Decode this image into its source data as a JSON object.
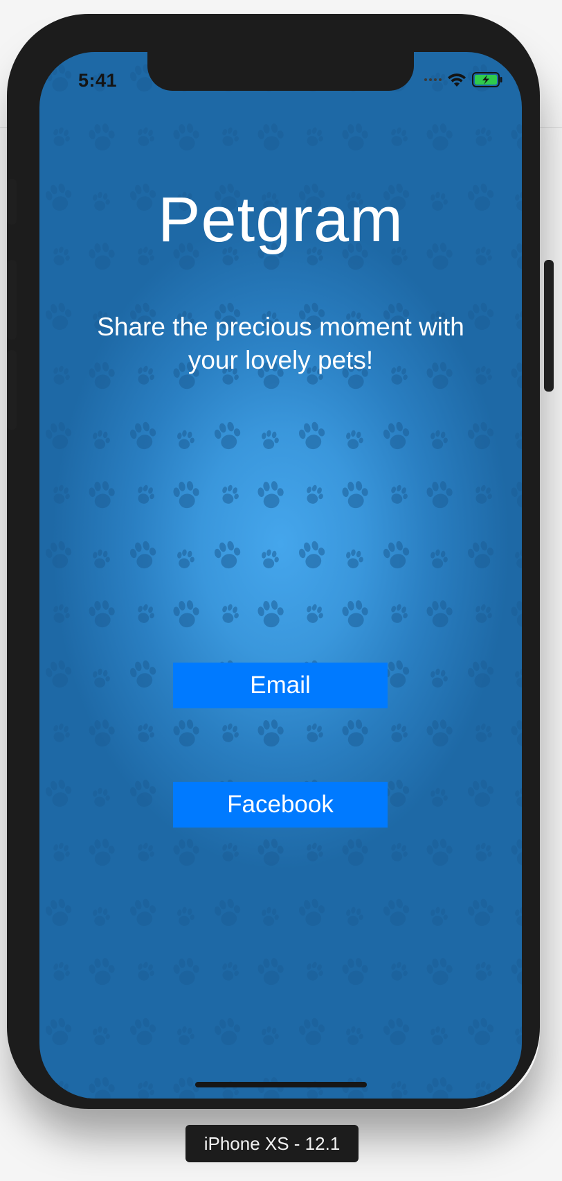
{
  "status_bar": {
    "time": "5:41"
  },
  "app": {
    "title": "Petgram",
    "tagline_line1": "Share the precious moment with",
    "tagline_line2": "your lovely pets!"
  },
  "buttons": {
    "email_label": "Email",
    "facebook_label": "Facebook"
  },
  "simulator": {
    "device_label": "iPhone XS - 12.1"
  },
  "colors": {
    "button_blue": "#007aff",
    "background_blue": "#2a7fc2",
    "background_highlight": "#45a6ec"
  },
  "icons": {
    "background_pattern": "paw-print-icon",
    "wifi": "wifi-icon",
    "battery": "battery-charging-icon",
    "signal": "cellular-signal-icon"
  }
}
